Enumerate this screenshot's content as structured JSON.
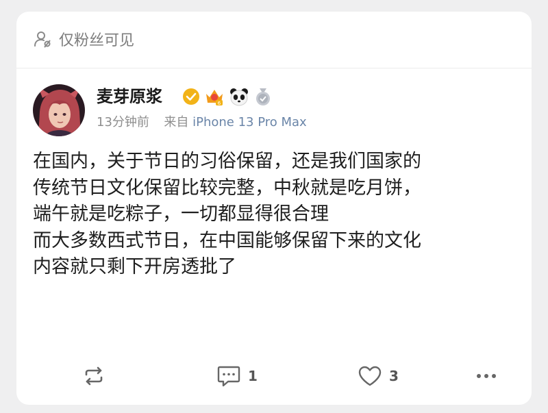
{
  "post": {
    "visibility": "仅粉丝可见",
    "author": {
      "name": "麦芽原浆"
    },
    "time": "13分钟前",
    "source_prefix": "来自",
    "device": "iPhone 13 Pro Max",
    "lines": [
      "在国内，关于节日的习俗保留，还是我们国家的",
      "传统节日文化保留比较完整，中秋就是吃月饼，",
      "端午就是吃粽子，一切都显得很合理",
      "而大多数西式节日，在中国能够保留下来的文化",
      "内容就只剩下开房透批了"
    ],
    "actions": {
      "comments": "1",
      "likes": "3"
    }
  },
  "colors": {
    "background": "#efeff0",
    "card": "#ffffff",
    "verified_badge": "#f2b318",
    "device_link": "#6a85a8"
  }
}
